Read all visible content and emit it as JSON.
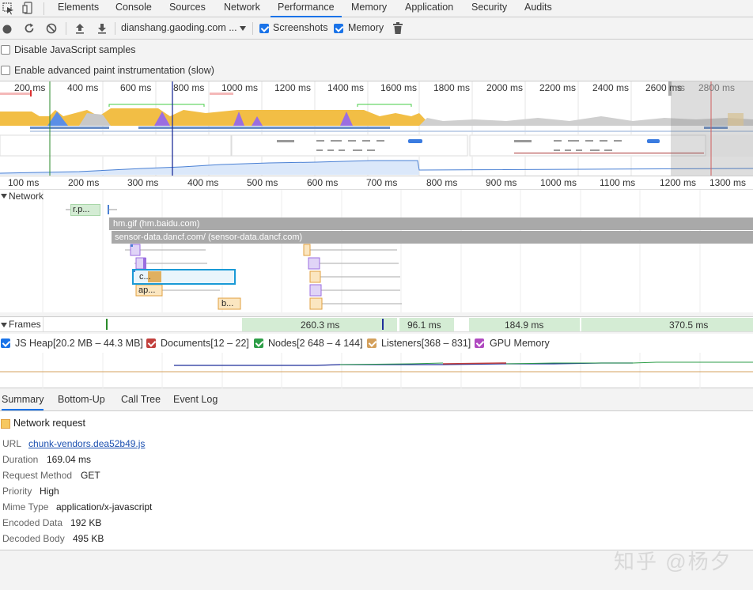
{
  "tabs": [
    "Elements",
    "Console",
    "Sources",
    "Network",
    "Performance",
    "Memory",
    "Application",
    "Security",
    "Audits"
  ],
  "active_tab": "Performance",
  "toolbar": {
    "profile_select": "dianshang.gaoding.com ...",
    "screenshots_label": "Screenshots",
    "memory_label": "Memory"
  },
  "settings": {
    "disable_js_samples": "Disable JavaScript samples",
    "advanced_paint": "Enable advanced paint instrumentation (slow)"
  },
  "overview_ruler": [
    "200 ms",
    "400 ms",
    "600 ms",
    "800 ms",
    "1000 ms",
    "1200 ms",
    "1400 ms",
    "1600 ms",
    "1800 ms",
    "2000 ms",
    "2200 ms",
    "2400 ms",
    "2600 ms",
    "ms",
    "2800 ms"
  ],
  "detail_ruler": [
    "100 ms",
    "200 ms",
    "300 ms",
    "400 ms",
    "500 ms",
    "600 ms",
    "700 ms",
    "800 ms",
    "900 ms",
    "1000 ms",
    "1100 ms",
    "1200 ms",
    "1300 ms"
  ],
  "network": {
    "title": "Network",
    "bars": [
      "r.p...",
      "hm.gif (hm.baidu.com)",
      "sensor-data.dancf.com/ (sensor-data.dancf.com)",
      "c...",
      "ap...",
      "b..."
    ]
  },
  "frames": {
    "title": "Frames",
    "values": [
      "260.3 ms",
      "96.1 ms",
      "184.9 ms",
      "370.5 ms"
    ]
  },
  "counters": [
    "JS Heap[20.2 MB – 44.3 MB]",
    "Documents[12 – 22]",
    "Nodes[2 648 – 4 144]",
    "Listeners[368 – 831]",
    "GPU Memory"
  ],
  "counter_colors": [
    "#1a73e8",
    "#c2403d",
    "#2e9e48",
    "#d4a05c",
    "#b04ac0"
  ],
  "bottom_tabs": [
    "Summary",
    "Bottom-Up",
    "Call Tree",
    "Event Log"
  ],
  "summary": {
    "title": "Network request",
    "rows": [
      {
        "key": "URL",
        "value": "chunk-vendors.dea52b49.js"
      },
      {
        "key": "Duration",
        "value": "169.04 ms"
      },
      {
        "key": "Request Method",
        "value": "GET"
      },
      {
        "key": "Priority",
        "value": "High"
      },
      {
        "key": "Mime Type",
        "value": "application/x-javascript"
      },
      {
        "key": "Encoded Data",
        "value": "192 KB"
      },
      {
        "key": "Decoded Body",
        "value": "495 KB"
      }
    ]
  },
  "watermark": "知乎 @杨夕"
}
